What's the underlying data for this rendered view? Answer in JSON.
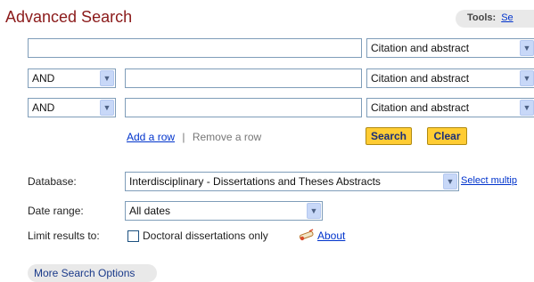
{
  "page": {
    "title": "Advanced Search"
  },
  "tools": {
    "label": "Tools:",
    "link": "Se"
  },
  "search_rows": [
    {
      "operator": null,
      "text": "",
      "field": "Citation and abstract"
    },
    {
      "operator": "AND",
      "text": "",
      "field": "Citation and abstract"
    },
    {
      "operator": "AND",
      "text": "",
      "field": "Citation and abstract"
    }
  ],
  "row_actions": {
    "add": "Add a row",
    "separator": "|",
    "remove": "Remove a row"
  },
  "buttons": {
    "search": "Search",
    "clear": "Clear"
  },
  "database": {
    "label": "Database:",
    "value": "Interdisciplinary - Dissertations and Theses Abstracts",
    "select_multiple": "Select multip"
  },
  "date_range": {
    "label": "Date range:",
    "value": "All dates"
  },
  "limit": {
    "label": "Limit results to:",
    "checkbox_label": "Doctoral dissertations only",
    "about": "About"
  },
  "more_options": "More Search Options"
}
